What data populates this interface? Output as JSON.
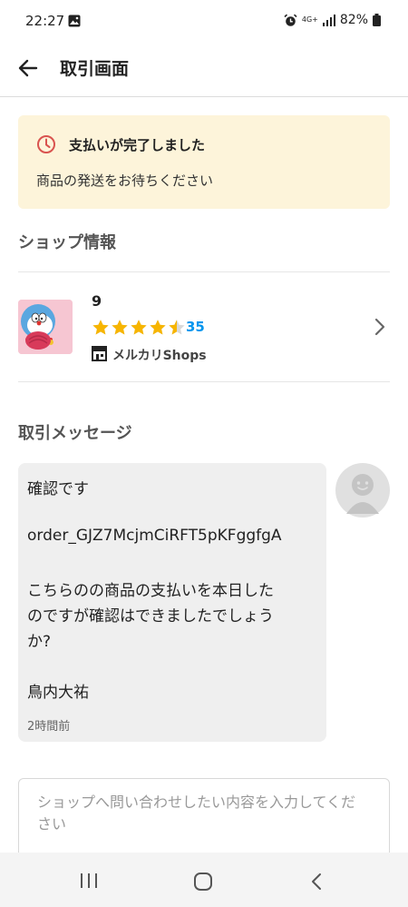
{
  "status_bar": {
    "time": "22:27",
    "network": "4G+",
    "battery": "82%"
  },
  "header": {
    "title": "取引画面"
  },
  "notice": {
    "title": "支払いが完了しました",
    "text": "商品の発送をお待ちください",
    "icon": "clock-icon",
    "icon_color": "#d9534f",
    "background": "#fdf4da"
  },
  "shop_section": {
    "title": "ショップ情報",
    "shop_name": "9",
    "rating": 4.5,
    "rating_max": 5,
    "rating_count": "35",
    "shops_label": "メルカリShops",
    "star_color": "#f7b500",
    "rating_count_color": "#0095ee"
  },
  "message_section": {
    "title": "取引メッセージ",
    "message_lines": [
      "確認です",
      "",
      "order_GJZ7McjmCiRFT5pKFggfgA",
      "",
      "こちらのの商品の支払いを本日した",
      "のですが確認はできましたでしょう",
      "か?",
      "",
      "鳥内大祐"
    ],
    "timestamp": "2時間前"
  },
  "inquiry": {
    "placeholder_line1": "ショップへ問い合わせしたい内容を入力してくだ",
    "placeholder_line2": "さい"
  },
  "nav_bar": {
    "icons": [
      "recent-apps-icon",
      "home-icon",
      "back-icon"
    ]
  }
}
